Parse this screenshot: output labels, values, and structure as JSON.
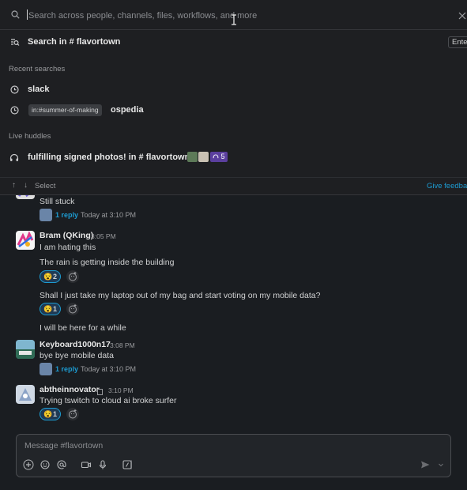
{
  "search": {
    "placeholder": "Search across people, channels, files, workflows, and more",
    "scope_label": "Search in # flavortown",
    "enter_key": "Enter"
  },
  "recent": {
    "heading": "Recent searches",
    "items": [
      {
        "text": "slack"
      },
      {
        "chip": "in:#summer-of-making",
        "text": "ospedia"
      }
    ]
  },
  "huddles": {
    "heading": "Live huddles",
    "item_label": "fulfilling signed photos! in # flavortown",
    "count": "5"
  },
  "nav": {
    "select_label": "Select",
    "feedback_label": "Give feedback"
  },
  "messages": {
    "m0_text": "Still stuck",
    "m0_reply_count": "1 reply",
    "m0_reply_time": "Today at 3:10 PM",
    "m1_author": "Bram (QKing)",
    "m1_time": "3:05 PM",
    "m1_lines": [
      "I am hating this",
      "The rain is getting inside the building",
      "Shall I just take my laptop out of my bag and start voting on my mobile data?",
      "I will be here for a while"
    ],
    "m1_reactions": [
      "2",
      "1"
    ],
    "m2_author": "Keyboard1000n17",
    "m2_time": "3:08 PM",
    "m2_text": "bye bye mobile data",
    "m2_reply_count": "1 reply",
    "m2_reply_time": "Today at 3:10 PM",
    "m3_author": "abtheinnovator",
    "m3_time": "3:10 PM",
    "m3_text": "Trying tswitch to cloud ai broke surfer",
    "m3_reaction": "1"
  },
  "composer": {
    "placeholder": "Message #flavortown"
  },
  "colors": {
    "background": "#1a1d21",
    "overlay": "#1e1f22",
    "link": "#1d9bd1",
    "huddle_badge": "#5b3f9e"
  }
}
